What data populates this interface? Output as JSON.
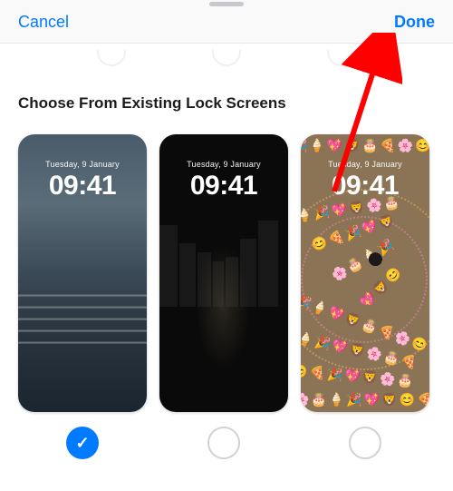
{
  "nav": {
    "cancel_label": "Cancel",
    "done_label": "Done"
  },
  "section": {
    "title": "Choose From Existing Lock Screens"
  },
  "lockscreens": [
    {
      "date": "Tuesday, 9 January",
      "time": "09:41",
      "selected": true,
      "theme": "city-fog"
    },
    {
      "date": "Tuesday, 9 January",
      "time": "09:41",
      "selected": false,
      "theme": "dark-street"
    },
    {
      "date": "Tuesday, 9 January",
      "time": "09:41",
      "selected": false,
      "theme": "emoji-spiral"
    }
  ],
  "colors": {
    "ios_blue": "#007aff",
    "selector_border": "#d1d1d6"
  },
  "annotation": {
    "arrow_target": "done-button",
    "arrow_color": "#ff0000"
  }
}
